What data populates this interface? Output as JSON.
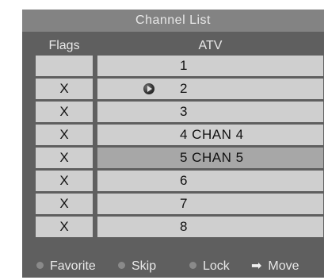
{
  "title": "Channel List",
  "columns": {
    "flags": "Flags",
    "atv": "ATV"
  },
  "rows": [
    {
      "flag": "",
      "channel": "1",
      "favorite": false,
      "selected": false
    },
    {
      "flag": "X",
      "channel": "2",
      "favorite": true,
      "selected": false
    },
    {
      "flag": "X",
      "channel": "3",
      "favorite": false,
      "selected": false
    },
    {
      "flag": "X",
      "channel": "4 CHAN 4",
      "favorite": false,
      "selected": false
    },
    {
      "flag": "X",
      "channel": "5 CHAN 5",
      "favorite": false,
      "selected": true
    },
    {
      "flag": "X",
      "channel": "6",
      "favorite": false,
      "selected": false
    },
    {
      "flag": "X",
      "channel": "7",
      "favorite": false,
      "selected": false
    },
    {
      "flag": "X",
      "channel": "8",
      "favorite": false,
      "selected": false
    }
  ],
  "footer": {
    "favorite": "Favorite",
    "skip": "Skip",
    "lock": "Lock",
    "move": "Move"
  },
  "icons": {
    "favorite_marker": "play-circle-icon",
    "legend_dot": "dot-icon",
    "move_arrow": "arrow-right-icon"
  }
}
